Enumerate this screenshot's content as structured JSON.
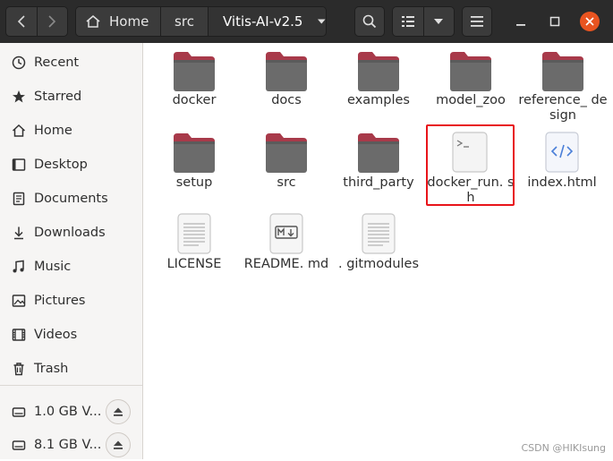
{
  "header": {
    "breadcrumb": [
      {
        "label": "Home",
        "icon": "home-icon"
      },
      {
        "label": "src"
      },
      {
        "label": "Vitis-AI-v2.5",
        "active": true
      }
    ]
  },
  "sidebar": {
    "items": [
      {
        "label": "Recent",
        "icon": "clock-icon"
      },
      {
        "label": "Starred",
        "icon": "star-icon"
      },
      {
        "label": "Home",
        "icon": "home-icon"
      },
      {
        "label": "Desktop",
        "icon": "desktop-icon"
      },
      {
        "label": "Documents",
        "icon": "document-icon"
      },
      {
        "label": "Downloads",
        "icon": "download-icon"
      },
      {
        "label": "Music",
        "icon": "music-icon"
      },
      {
        "label": "Pictures",
        "icon": "picture-icon"
      },
      {
        "label": "Videos",
        "icon": "video-icon"
      },
      {
        "label": "Trash",
        "icon": "trash-icon"
      }
    ],
    "volumes": [
      {
        "label": "1.0 GB V...",
        "icon": "drive-icon"
      },
      {
        "label": "8.1 GB V...",
        "icon": "drive-icon"
      }
    ]
  },
  "files": [
    {
      "name": "docker",
      "type": "folder"
    },
    {
      "name": "docs",
      "type": "folder"
    },
    {
      "name": "examples",
      "type": "folder"
    },
    {
      "name": "model_zoo",
      "type": "folder"
    },
    {
      "name": "reference_ design",
      "type": "folder"
    },
    {
      "name": "setup",
      "type": "folder"
    },
    {
      "name": "src",
      "type": "folder"
    },
    {
      "name": "third_party",
      "type": "folder"
    },
    {
      "name": "docker_run. sh",
      "type": "script",
      "highlighted": true
    },
    {
      "name": "index.html",
      "type": "html"
    },
    {
      "name": "LICENSE",
      "type": "text"
    },
    {
      "name": "README. md",
      "type": "markdown"
    },
    {
      "name": ". gitmodules",
      "type": "text"
    }
  ],
  "colors": {
    "header_bg": "#2b2b2b",
    "folder_body": "#6b6b6b",
    "folder_tab": "#a83a4a",
    "close_button": "#e95420",
    "highlight_border": "#e8141a"
  },
  "watermark": "CSDN @HIKIsung"
}
